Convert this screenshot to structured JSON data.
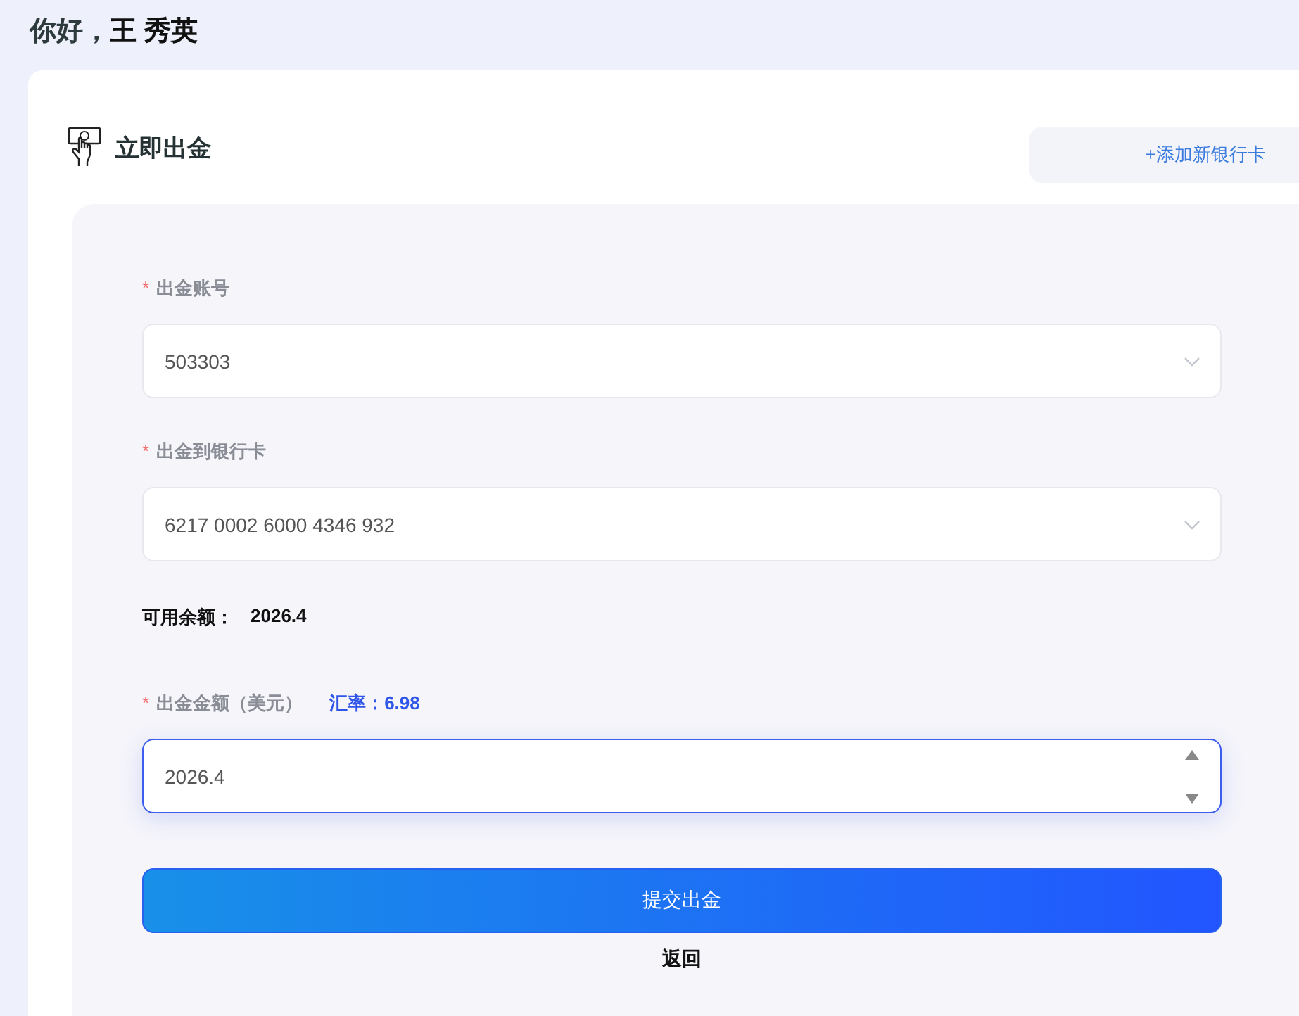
{
  "greeting": {
    "text": "你好，",
    "name": "王 秀英"
  },
  "section": {
    "title": "立即出金",
    "add_button": "+添加新银行卡"
  },
  "fields": [
    {
      "kind": "select",
      "required_mark": "*",
      "label": "出金账号",
      "value": "503303",
      "focused": false
    },
    {
      "kind": "select",
      "required_mark": "*",
      "label": "出金到银行卡",
      "value": "6217 0002 6000 4346 932",
      "focused": false
    },
    {
      "kind": "balance",
      "label": "可用余额：",
      "value": "2026.4"
    },
    {
      "kind": "number",
      "required_mark": "*",
      "label": "出金金额（美元）",
      "extra": "汇率：6.98",
      "value": "2026.4",
      "focused": true
    }
  ],
  "submit_button": "提交出金",
  "back_link": "返回"
}
